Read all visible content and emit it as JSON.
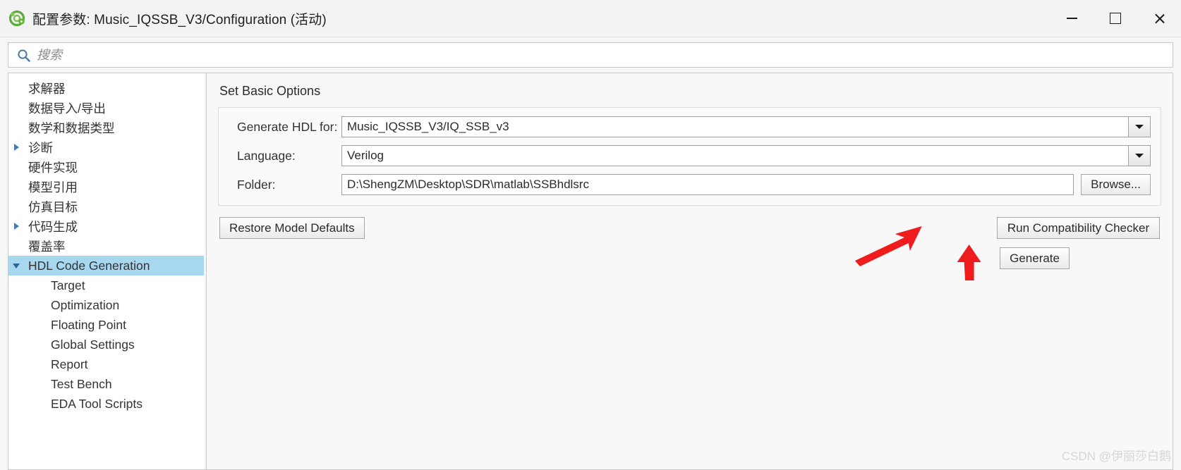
{
  "window": {
    "title": "配置参数: Music_IQSSB_V3/Configuration (活动)",
    "app_icon": "simulink-config-icon",
    "controls": {
      "minimize": "minimize-icon",
      "maximize": "maximize-icon",
      "close": "close-icon"
    }
  },
  "search": {
    "icon": "search-icon",
    "placeholder": "搜索",
    "value": ""
  },
  "sidebar": {
    "items": [
      {
        "label": "求解器",
        "level": 0,
        "twisty": "none",
        "selected": false
      },
      {
        "label": "数据导入/导出",
        "level": 0,
        "twisty": "none",
        "selected": false
      },
      {
        "label": "数学和数据类型",
        "level": 0,
        "twisty": "none",
        "selected": false
      },
      {
        "label": "诊断",
        "level": 0,
        "twisty": "right",
        "selected": false
      },
      {
        "label": "硬件实现",
        "level": 0,
        "twisty": "none",
        "selected": false
      },
      {
        "label": "模型引用",
        "level": 0,
        "twisty": "none",
        "selected": false
      },
      {
        "label": "仿真目标",
        "level": 0,
        "twisty": "none",
        "selected": false
      },
      {
        "label": "代码生成",
        "level": 0,
        "twisty": "right",
        "selected": false
      },
      {
        "label": "覆盖率",
        "level": 0,
        "twisty": "none",
        "selected": false
      },
      {
        "label": "HDL Code Generation",
        "level": 0,
        "twisty": "down",
        "selected": true
      },
      {
        "label": "Target",
        "level": 1,
        "twisty": "none",
        "selected": false
      },
      {
        "label": "Optimization",
        "level": 1,
        "twisty": "none",
        "selected": false
      },
      {
        "label": "Floating Point",
        "level": 1,
        "twisty": "none",
        "selected": false
      },
      {
        "label": "Global Settings",
        "level": 1,
        "twisty": "none",
        "selected": false
      },
      {
        "label": "Report",
        "level": 1,
        "twisty": "none",
        "selected": false
      },
      {
        "label": "Test Bench",
        "level": 1,
        "twisty": "none",
        "selected": false
      },
      {
        "label": "EDA Tool Scripts",
        "level": 1,
        "twisty": "none",
        "selected": false
      }
    ]
  },
  "panel": {
    "title": "Set Basic Options",
    "fields": {
      "generate_hdl_for": {
        "label": "Generate HDL for:",
        "value": "Music_IQSSB_V3/IQ_SSB_v3",
        "control": "combobox"
      },
      "language": {
        "label": "Language:",
        "value": "Verilog",
        "control": "combobox"
      },
      "folder": {
        "label": "Folder:",
        "value": "D:\\ShengZM\\Desktop\\SDR\\matlab\\SSBhdlsrc",
        "control": "textfield"
      }
    },
    "buttons": {
      "browse": "Browse...",
      "restore_defaults": "Restore Model Defaults",
      "run_compatibility_checker": "Run Compatibility Checker",
      "generate": "Generate"
    },
    "annotations": {
      "arrow_color": "#ee1c1c",
      "arrow_to_compatibility": "red-arrow-to-run-compatibility-checker",
      "arrow_to_generate": "red-arrow-to-generate"
    }
  },
  "watermark": {
    "text": "CSDN @伊丽莎白鹅"
  },
  "colors": {
    "titlebar_bg": "#f3f3f3",
    "panel_bg": "#f8f8f8",
    "selection_blue": "#a8d8f0",
    "accent_red": "#ee1c1c",
    "icon_green": "#4caf3f"
  }
}
